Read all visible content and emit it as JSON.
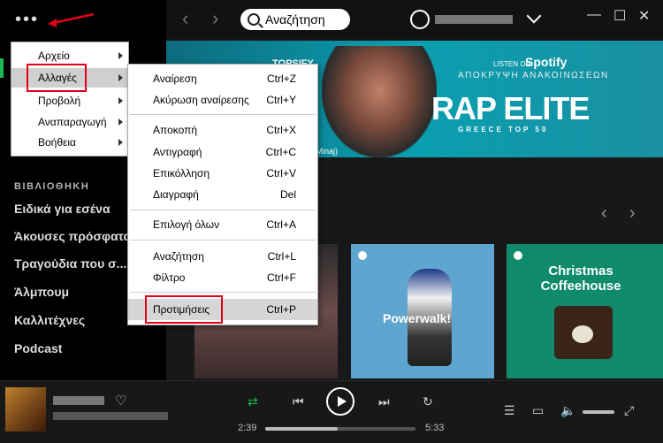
{
  "sidebar": {
    "library_title": "ΒΙΒΛΙΟΘΗΚΗ",
    "items": [
      "Ειδικά για εσένα",
      "Άκουσες πρόσφατα",
      "Τραγούδια που σ...",
      "Άλμπουμ",
      "Καλλιτέχνες",
      "Podcast"
    ]
  },
  "topbar": {
    "search_label": "Αναζήτηση",
    "nav_back": "‹",
    "nav_forward": "›",
    "minimize": "—",
    "maximize": "☐",
    "close": "✕"
  },
  "banner": {
    "topsify": "TOPSIFY",
    "caption": "ensive (feat. Nicki Minaj)",
    "listen_on": "LISTEN ON",
    "spotify": "Spotify",
    "hide_ads": "ΑΠΟΚΡΥΨΗ ΑΝΑΚΟΙΝΩΣΕΩΝ",
    "headline": "RAP ELITE",
    "subhead": "GREECE TOP 50"
  },
  "cards": {
    "powerwalk": "Powerwalk!",
    "christmas": "Christmas Coffeehouse"
  },
  "menu_main": {
    "items": [
      {
        "label": "Αρχείο"
      },
      {
        "label": "Αλλαγές"
      },
      {
        "label": "Προβολή"
      },
      {
        "label": "Αναπαραγωγή"
      },
      {
        "label": "Βοήθεια"
      }
    ],
    "selected": "Αλλαγές"
  },
  "menu_edit": {
    "items": [
      {
        "label": "Αναίρεση",
        "shortcut": "Ctrl+Z"
      },
      {
        "label": "Ακύρωση αναίρεσης",
        "shortcut": "Ctrl+Y"
      },
      {
        "label": "Αποκοπή",
        "shortcut": "Ctrl+X"
      },
      {
        "label": "Αντιγραφή",
        "shortcut": "Ctrl+C"
      },
      {
        "label": "Επικόλληση",
        "shortcut": "Ctrl+V"
      },
      {
        "label": "Διαγραφή",
        "shortcut": "Del"
      },
      {
        "label": "Επιλογή όλων",
        "shortcut": "Ctrl+A"
      },
      {
        "label": "Αναζήτηση",
        "shortcut": "Ctrl+L"
      },
      {
        "label": "Φίλτρο",
        "shortcut": "Ctrl+F"
      },
      {
        "label": "Προτιμήσεις",
        "shortcut": "Ctrl+P"
      }
    ],
    "highlighted": "Προτιμήσεις"
  },
  "player": {
    "elapsed": "2:39",
    "duration": "5:33",
    "progress_fraction": 0.48,
    "volume_fraction": 0.8
  },
  "colors": {
    "accent": "#1db954",
    "highlight_box": "#e0001a",
    "sidebar_bg": "#000000",
    "main_bg": "#181818"
  },
  "icons": [
    "menu-dots-icon",
    "search-icon",
    "user-icon",
    "chevron-down-icon",
    "heart-icon",
    "shuffle-icon",
    "prev-icon",
    "play-icon",
    "next-icon",
    "repeat-icon",
    "queue-icon",
    "devices-icon",
    "volume-icon",
    "fullscreen-icon"
  ]
}
